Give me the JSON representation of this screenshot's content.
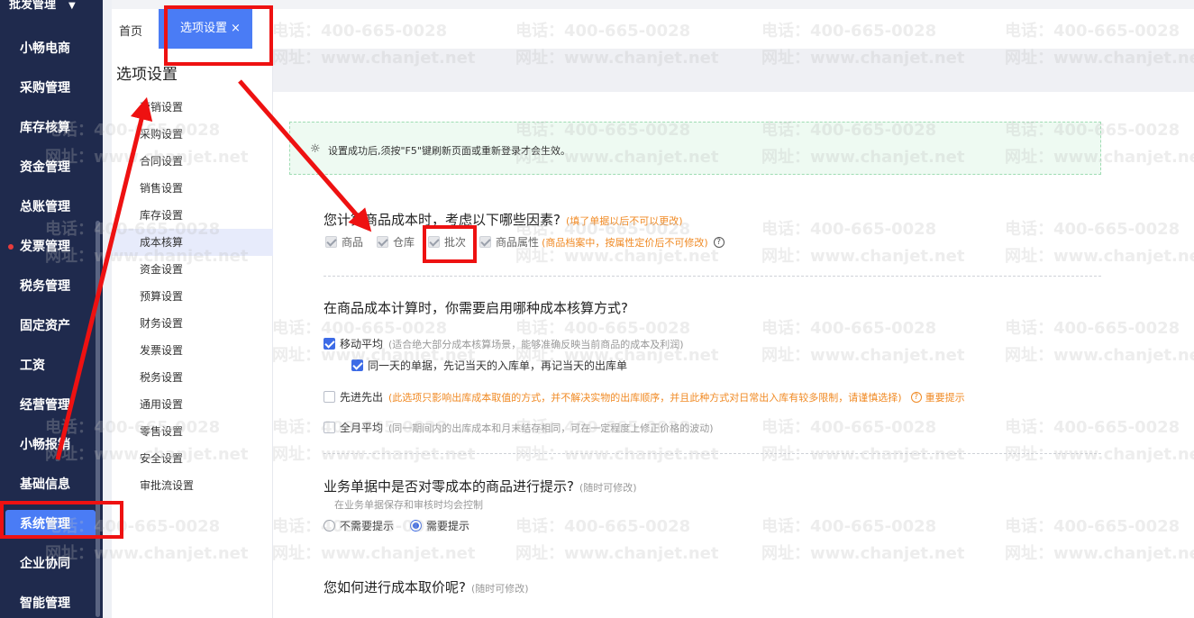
{
  "nav": {
    "top_label": "批发管理",
    "items": [
      {
        "label": "小畅电商"
      },
      {
        "label": "采购管理"
      },
      {
        "label": "库存核算"
      },
      {
        "label": "资金管理"
      },
      {
        "label": "总账管理"
      },
      {
        "label": "发票管理",
        "dot": true
      },
      {
        "label": "税务管理"
      },
      {
        "label": "固定资产"
      },
      {
        "label": "工资"
      },
      {
        "label": "经营管理"
      },
      {
        "label": "小畅报销"
      },
      {
        "label": "基础信息"
      },
      {
        "label": "系统管理",
        "active": true
      },
      {
        "label": "企业协同"
      },
      {
        "label": "智能管理"
      }
    ]
  },
  "tabs": {
    "home": "首页",
    "active": "选项设置",
    "close": "×"
  },
  "menu": {
    "title": "选项设置",
    "items": [
      {
        "label": "营销设置"
      },
      {
        "label": "采购设置"
      },
      {
        "label": "合同设置"
      },
      {
        "label": "销售设置"
      },
      {
        "label": "库存设置"
      },
      {
        "label": "成本核算",
        "active": true
      },
      {
        "label": "资金设置"
      },
      {
        "label": "预算设置"
      },
      {
        "label": "财务设置"
      },
      {
        "label": "发票设置"
      },
      {
        "label": "税务设置"
      },
      {
        "label": "通用设置"
      },
      {
        "label": "零售设置"
      },
      {
        "label": "安全设置"
      },
      {
        "label": "审批流设置"
      }
    ]
  },
  "notice": {
    "icon": "lightbulb-icon",
    "text": "设置成功后,须按\"F5\"键刷新页面或重新登录才会生效。"
  },
  "q1": {
    "title": "您计算商品成本时，考虑以下哪些因素?",
    "note": "(填了单据以后不可以更改)",
    "options": [
      "商品",
      "仓库",
      "批次",
      "商品属性"
    ],
    "attr_note": "(商品档案中，按属性定价后不可修改)",
    "help": "?"
  },
  "q2": {
    "title": "在商品成本计算时，你需要启用哪种成本核算方式?",
    "moving": {
      "label": "移动平均",
      "note": "(适合绝大部分成本核算场景，能够准确反映当前商品的成本及利润)"
    },
    "same_day": "同一天的单据，先记当天的入库单，再记当天的出库单",
    "fifo": {
      "label": "先进先出",
      "note": "(此选项只影响出库成本取值的方式，并不解决实物的出库顺序，并且此种方式对日常出入库有较多限制，请谨慎选择)",
      "tip": "重要提示"
    },
    "monthly": {
      "label": "全月平均",
      "note": "(同一期间内的出库成本和月末结存相同，可在一定程度上修正价格的波动)"
    }
  },
  "q3": {
    "title": "业务单据中是否对零成本的商品进行提示?",
    "note": "(随时可修改)",
    "sub": "在业务单据保存和审核时均会控制",
    "options": [
      "不需要提示",
      "需要提示"
    ],
    "selected": "需要提示"
  },
  "q4": {
    "title": "您如何进行成本取价呢?",
    "note": "(随时可修改)"
  },
  "watermark": {
    "phone": "电话：400-665-0028",
    "site": "网址：www.chanjet.net"
  },
  "colors": {
    "nav_bg": "#1f2a4d",
    "accent": "#4a7cf5",
    "annotation": "#ee1111",
    "warn": "#f08a24"
  }
}
